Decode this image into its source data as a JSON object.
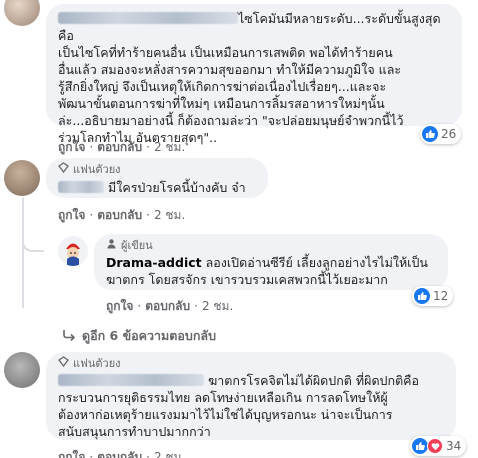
{
  "comment1": {
    "text": "ไซโคมันมีหลายระดับ...ระดับขั้นสูงสุดคือเป็นไซโคที่ทำร้ายคนอื่น เป็นเหมือนการเสพติด พอได้ทำร้ายคนอื่นแล้ว สมองจะหลั่งสารความสุขออกมา ทำให้มีความภูมิใจ และรู้สึกยิ่งใหญ่ จึงเป็นเหตุให้เกิดการฆ่าต่อเนื่องไปเรื่อยๆ...และจะพัฒนาขั้นตอนการฆ่าที่ใหม่ๆ เหมือนการลิ้มรสอาหารใหม่ๆนั้นล่ะ...อธิบายมาอย่างนี้ ก็ต้องถามล่ะว่า \"จะปล่อยมนุษย์จำพวกนี้ไว้ร่วมโลกทำไม อันตรายสุดๆ\"..",
    "lines": [
      "ไซโคมันมีหลายระดับ...ระดับขั้นสูงสุดคือ",
      "เป็นไซโคที่ทำร้ายคนอื่น เป็นเหมือนการเสพติด พอได้ทำร้ายคน",
      "อื่นแล้ว สมองจะหลั่งสารความสุขออกมา ทำให้มีความภูมิใจ และ",
      "รู้สึกยิ่งใหญ่ จึงเป็นเหตุให้เกิดการฆ่าต่อเนื่องไปเรื่อยๆ...และจะ",
      "พัฒนาขั้นตอนการฆ่าที่ใหม่ๆ เหมือนการลิ้มรสอาหารใหม่ๆนั้น",
      "ล่ะ...อธิบายมาอย่างนี้ ก็ต้องถามล่ะว่า \"จะปล่อยมนุษย์จำพวกนี้ไว้",
      "ร่วมโลกทำไม อันตรายสุดๆ\".."
    ],
    "like": "ถูกใจ",
    "reply": "ตอบกลับ",
    "time": "2 ชม.",
    "reaction_count": "26"
  },
  "comment2": {
    "badge": "แฟนตัวยง",
    "text": "มีใครป่วยโรคนี้บ้างคับ จ๋า",
    "like": "ถูกใจ",
    "reply": "ตอบกลับ",
    "time": "2 ชม."
  },
  "reply1": {
    "badge": "ผู้เขียน",
    "author": "Drama-addict",
    "text_line1": "ลองเปิดอ่านซีรีย์ เลี้ยงลูกอย่างไรไม่ให้เป็น",
    "text_line2": "ฆาตกร โดยสรจักร เขารวบรวมเคสพวกนี้ไว้เยอะมาก",
    "like": "ถูกใจ",
    "reply": "ตอบกลับ",
    "time": "2 ชม.",
    "reaction_count": "12"
  },
  "more_replies": "ดูอีก 6 ข้อความตอบกลับ",
  "comment3": {
    "badge": "แฟนตัวยง",
    "lines": [
      "ฆาตกรโรคจิตไม่ได้ผิดปกติ ที่ผิดปกติคือ",
      "กระบวนการยุติธรรมไทย ลดโทษง่ายเหลือเกิน การลดโทษให้ผู้",
      "ต้องหาก่อเหตุร้ายแรงมมาไว้ไม่ใช่ได้บุญหรอกนะ น่าจะเป็นการ",
      "สนับสนุนการทำบาปมากกว่า"
    ],
    "like": "ถูกใจ",
    "reply": "ตอบกลับ",
    "time": "2 ชม.",
    "reaction_count": "34"
  },
  "colors": {
    "like_blue": "#1877f2",
    "heart_red": "#f33e58",
    "bubble": "#f0f2f5",
    "meta_gray": "#65676b"
  },
  "icons": [
    "like-icon",
    "heart-icon",
    "fan-badge-icon",
    "author-badge-icon",
    "reply-arrow-icon"
  ]
}
